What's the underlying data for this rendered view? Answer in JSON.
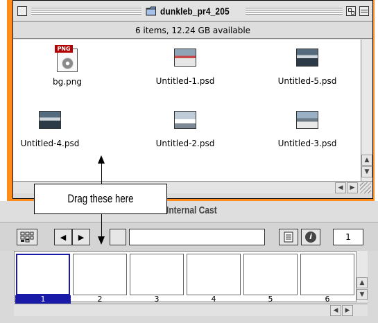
{
  "finder": {
    "title": "dunkleb_pr4_205",
    "status": "6 items, 12.24 GB available",
    "files": [
      {
        "name": "bg.png",
        "icon": "png-file-icon"
      },
      {
        "name": "Untitled-1.psd",
        "icon": "photo-thumbnail"
      },
      {
        "name": "Untitled-5.psd",
        "icon": "photo-thumbnail"
      },
      {
        "name": "Untitled-4.psd",
        "icon": "photo-thumbnail"
      },
      {
        "name": "Untitled-2.psd",
        "icon": "photo-thumbnail"
      },
      {
        "name": "Untitled-3.psd",
        "icon": "photo-thumbnail"
      }
    ],
    "png_badge": "PNG"
  },
  "callout": {
    "text": "Drag these here"
  },
  "cast": {
    "title": "Internal Cast",
    "name_field": "",
    "member_number": "1",
    "cells": [
      "1",
      "2",
      "3",
      "4",
      "5",
      "6"
    ]
  },
  "colors": {
    "window_frame": "#ff8c1a",
    "selection": "#1a1aa8"
  }
}
